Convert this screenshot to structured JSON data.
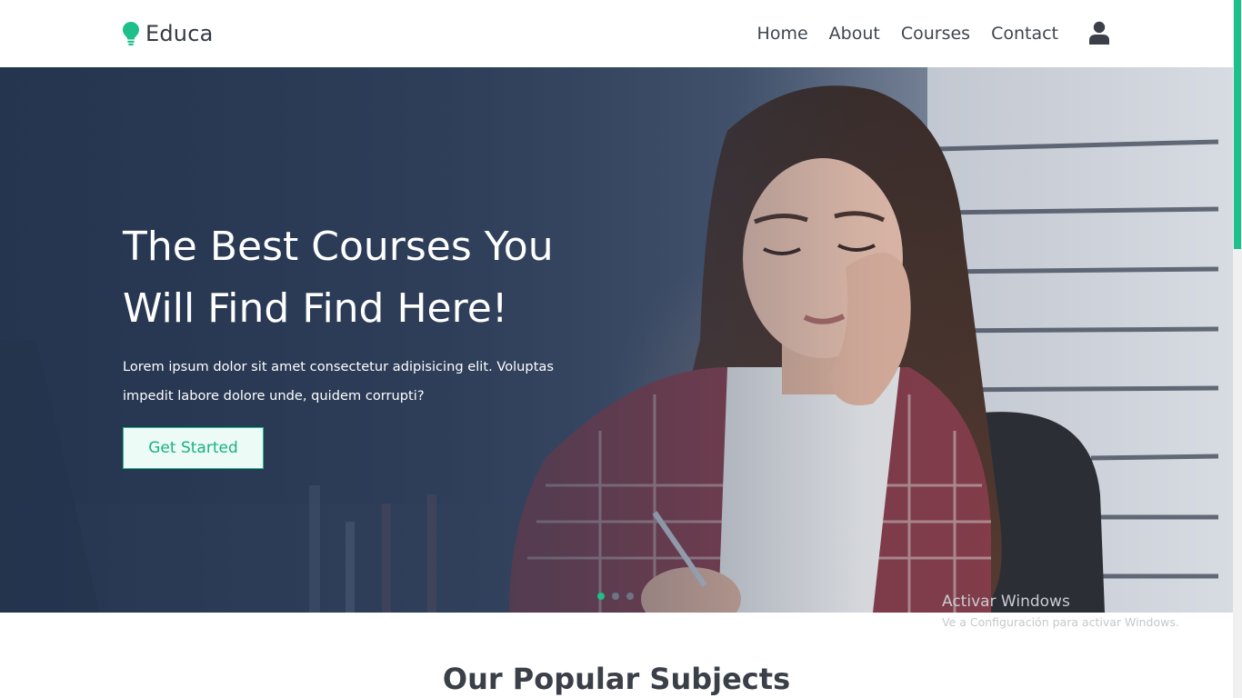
{
  "header": {
    "brand": "Educa",
    "logo_icon": "lightbulb-icon",
    "nav": [
      {
        "label": "Home"
      },
      {
        "label": "About"
      },
      {
        "label": "Courses"
      },
      {
        "label": "Contact"
      }
    ],
    "user_icon": "user-icon"
  },
  "hero": {
    "title_line1": "The Best Courses You",
    "title_line2": "Will Find Find Here!",
    "text": "Lorem ipsum dolor sit amet consectetur adipisicing elit. Voluptas impedit labore dolore unde, quidem corrupti?",
    "cta_label": "Get Started",
    "slides": 3,
    "active_slide": 1
  },
  "watermark": {
    "title": "Activar Windows",
    "subtitle": "Ve a Configuración para activar Windows."
  },
  "section": {
    "title": "Our Popular Subjects"
  },
  "colors": {
    "accent": "#1ebf8a",
    "text_dark": "#3f4650",
    "hero_overlay": "#2a3a55"
  }
}
